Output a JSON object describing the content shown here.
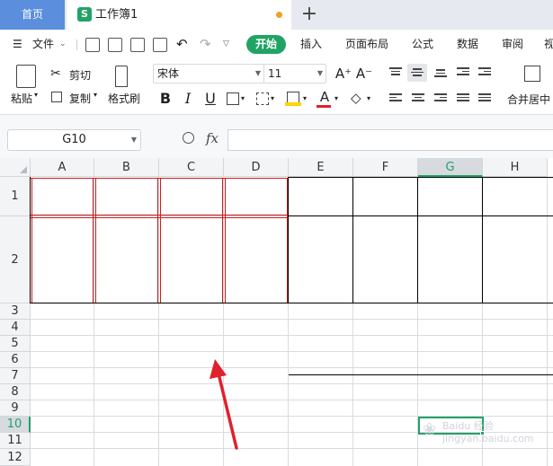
{
  "tabs": {
    "home": "首页",
    "document": "工作簿1",
    "add": "+"
  },
  "menu": {
    "file": "文件",
    "items": [
      "开始",
      "插入",
      "页面布局",
      "公式",
      "数据",
      "审阅",
      "视"
    ]
  },
  "ribbon": {
    "paste": "粘贴",
    "cut": "剪切",
    "copy": "复制",
    "format_painter": "格式刷",
    "font_name": "宋体",
    "font_size": "11",
    "bold": "B",
    "italic": "I",
    "underline": "U",
    "font_color": "A",
    "merge_center": "合并居中",
    "grow_font": "A⁺",
    "shrink_font": "A⁻"
  },
  "formula_bar": {
    "name_box": "G10",
    "zoom_icon": "zoom-icon",
    "fx_label": "fx",
    "formula": ""
  },
  "grid": {
    "columns": [
      "A",
      "B",
      "C",
      "D",
      "E",
      "F",
      "G",
      "H"
    ],
    "rows": [
      "1",
      "2",
      "3",
      "4",
      "5",
      "6",
      "7",
      "8",
      "9",
      "10",
      "11",
      "12"
    ],
    "selected_cell": "G10",
    "selected_column": "G",
    "selected_row": "10"
  },
  "colors": {
    "accent": "#21a366",
    "tab_home": "#5b8fde",
    "annotation": "#e0202a"
  },
  "watermark": "Baidu 经验 jingyan.baidu.com"
}
